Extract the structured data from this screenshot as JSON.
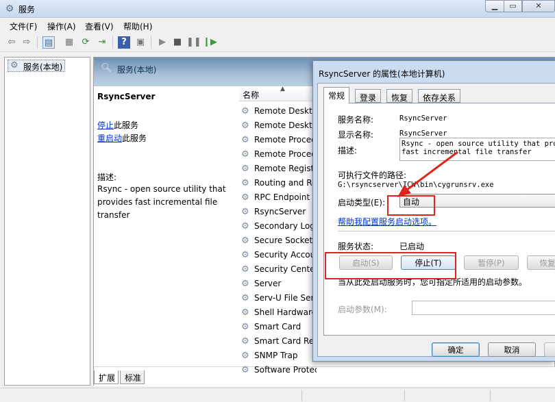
{
  "window": {
    "title": "服务"
  },
  "menu": [
    "文件(F)",
    "操作(A)",
    "查看(V)",
    "帮助(H)"
  ],
  "toolbar_icons": [
    "back-arrow-icon",
    "forward-arrow-icon",
    "show-tree-icon",
    "properties-icon",
    "refresh-icon",
    "export-icon",
    "help-icon",
    "console-icon",
    "play-icon",
    "stop-icon",
    "pause-icon",
    "restart-icon"
  ],
  "tree": {
    "item": "服务(本地)"
  },
  "main": {
    "header": "服务(本地)",
    "service_name": "RsyncServer",
    "stop_link": "停止",
    "stop_suffix": "此服务",
    "restart_link": "重启动",
    "restart_suffix": "此服务",
    "desc_label": "描述:",
    "desc_text": "Rsync - open source utility that provides fast incremental file transfer",
    "column_name": "名称",
    "rows": [
      "Remote Desktop",
      "Remote Desktop",
      "Remote Procedure",
      "Remote Procedure",
      "Remote Registry",
      "Routing and Remote",
      "RPC Endpoint Mapper",
      "RsyncServer",
      "Secondary Logon",
      "Secure Socket",
      "Security Accounts",
      "Security Center",
      "Server",
      "Serv-U File Server",
      "Shell Hardware",
      "Smart Card",
      "Smart Card Removal",
      "SNMP Trap",
      "Software Protect"
    ],
    "bottom_tabs": [
      "扩展",
      "标准"
    ]
  },
  "dialog": {
    "title": "RsyncServer 的属性(本地计算机)",
    "tabs": [
      "常规",
      "登录",
      "恢复",
      "依存关系"
    ],
    "service_name_label": "服务名称:",
    "service_name_value": "RsyncServer",
    "display_name_label": "显示名称:",
    "display_name_value": "RsyncServer",
    "description_label": "描述:",
    "description_line1": "Rsync - open source utility that provides",
    "description_line2": "fast incremental file transfer",
    "exe_path_label": "可执行文件的路径:",
    "exe_path_value": "G:\\rsyncserver\\ICW\\bin\\cygrunsrv.exe",
    "startup_type_label": "启动类型(E):",
    "startup_type_value": "自动",
    "help_link": "帮助我配置服务启动选项。",
    "status_label": "服务状态:",
    "status_value": "已启动",
    "btn_start": "启动(S)",
    "btn_stop": "停止(T)",
    "btn_pause": "暂停(P)",
    "btn_resume": "恢复",
    "start_params_note": "当从此处启动服务时，您可指定所适用的启动参数。",
    "start_params_label": "启动参数(M):",
    "start_params_value": "",
    "btn_ok": "确定",
    "btn_cancel": "取消"
  },
  "colors": {
    "annotation_red": "#e0231e",
    "link_blue": "#0033cc",
    "header_blue": "#6d8fb4"
  }
}
